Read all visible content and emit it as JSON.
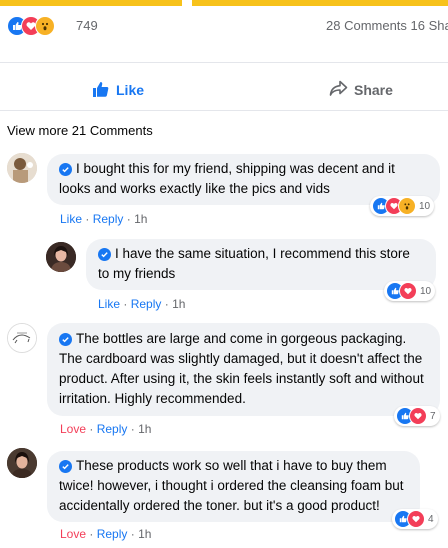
{
  "reactions": {
    "total": "749",
    "summary": "28 Comments 16 Sha"
  },
  "actions": {
    "like_label": "Like",
    "share_label": "Share"
  },
  "view_more": "View more 21 Comments",
  "comments": [
    {
      "text": "I bought this for my friend, shipping was decent and it looks and works exactly like the pics and vids",
      "react_label": "Like",
      "reply_label": "Reply",
      "time": "1h",
      "reaction_count": "10",
      "reaction_icons": [
        "like-icon",
        "love-icon",
        "wow-icon"
      ]
    },
    {
      "text": "I have the same situation, I recommend this store to my friends",
      "react_label": "Like",
      "reply_label": "Reply",
      "time": "1h",
      "reaction_count": "10",
      "reaction_icons": [
        "like-icon",
        "love-icon"
      ]
    },
    {
      "text": "The bottles are large and come in gorgeous packaging. The cardboard was slightly damaged, but it doesn't affect the product. After using it, the skin feels instantly soft and without irritation. Highly recommended.",
      "react_label": "Love",
      "reply_label": "Reply",
      "time": "1h",
      "reaction_count": "7",
      "reaction_icons": [
        "like-icon",
        "love-icon"
      ]
    },
    {
      "text": "These products work so well that i have to buy them twice! however, i thought i ordered the cleansing foam but accidentally ordered the toner. but it's a good product!",
      "react_label": "Love",
      "reply_label": "Reply",
      "time": "1h",
      "reaction_count": "4",
      "reaction_icons": [
        "like-icon",
        "love-icon"
      ]
    }
  ],
  "colors": {
    "accent": "#1877f2",
    "love": "#f33e58",
    "wow": "#f7b125",
    "bubble": "#f0f2f5",
    "muted": "#65676b",
    "topbar": "#f7c21b"
  }
}
